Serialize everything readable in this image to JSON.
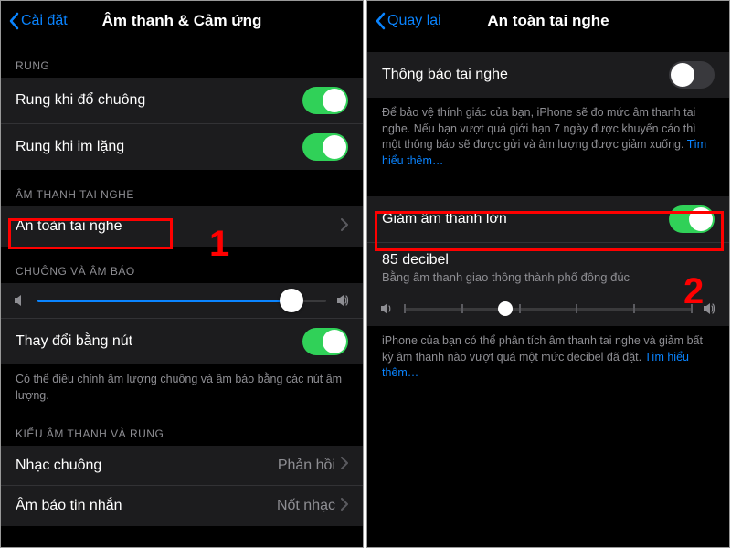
{
  "left": {
    "back_label": "Cài đặt",
    "title": "Âm thanh & Cảm ứng",
    "sections": {
      "vibrate_header": "RUNG",
      "ring_vibrate": "Rung khi đổ chuông",
      "silent_vibrate": "Rung khi im lặng",
      "headphone_header": "ÂM THANH TAI NGHE",
      "headphone_safety": "An toàn tai nghe",
      "ringer_header": "CHUÔNG VÀ ÂM BÁO",
      "change_with_buttons": "Thay đổi bằng nút",
      "ringer_footer": "Có thể điều chỉnh âm lượng chuông và âm báo bằng các nút âm lượng.",
      "sound_patterns_header": "KIỂU ÂM THANH VÀ RUNG",
      "ringtone": "Nhạc chuông",
      "ringtone_value": "Phản hồi",
      "news_sound": "Âm báo tin nhắn",
      "news_sound_value": "Nốt nhạc"
    },
    "switches": {
      "ring_vibrate": true,
      "silent_vibrate": true,
      "change_with_buttons": true
    },
    "ringer_slider_pct": 88,
    "annotation_number": "1"
  },
  "right": {
    "back_label": "Quay lại",
    "title": "An toàn tai nghe",
    "headphone_notifications": "Thông báo tai nghe",
    "headphone_notifications_on": false,
    "notifications_footer": "Để bảo vệ thính giác của bạn, iPhone sẽ đo mức âm thanh tai nghe. Nếu bạn vượt quá giới hạn 7 ngày được khuyến cáo thì một thông báo sẽ được gửi và âm lượng được giảm xuống.",
    "learn_more": "Tìm hiểu thêm…",
    "reduce_loud": "Giảm âm thanh lớn",
    "reduce_loud_on": true,
    "decibel_title": "85 decibel",
    "decibel_sub": "Bằng âm thanh giao thông thành phố đông đúc",
    "decibel_slider_pct": 35,
    "reduce_footer": "iPhone của bạn có thể phân tích âm thanh tai nghe và giảm bất kỳ âm thanh nào vượt quá một mức decibel đã đặt. ",
    "annotation_number": "2"
  }
}
